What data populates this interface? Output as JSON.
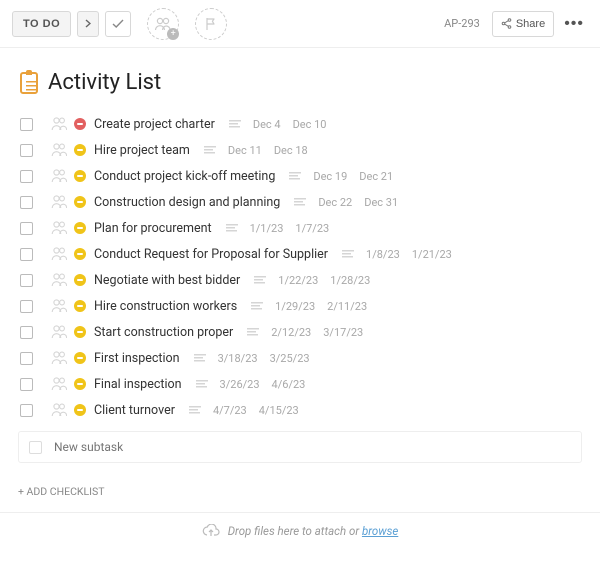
{
  "header": {
    "status_label": "TO DO",
    "task_id": "AP-293",
    "share_label": "Share"
  },
  "title": "Activity List",
  "tasks": [
    {
      "title": "Create project charter",
      "status": "red",
      "date1": "Dec 4",
      "date2": "Dec 10"
    },
    {
      "title": "Hire project team",
      "status": "yellow",
      "date1": "Dec 11",
      "date2": "Dec 18"
    },
    {
      "title": "Conduct project kick-off meeting",
      "status": "yellow",
      "date1": "Dec 19",
      "date2": "Dec 21"
    },
    {
      "title": "Construction design and planning",
      "status": "yellow",
      "date1": "Dec 22",
      "date2": "Dec 31"
    },
    {
      "title": "Plan for procurement",
      "status": "yellow",
      "date1": "1/1/23",
      "date2": "1/7/23"
    },
    {
      "title": "Conduct Request for Proposal for Supplier",
      "status": "yellow",
      "date1": "1/8/23",
      "date2": "1/21/23"
    },
    {
      "title": "Negotiate with best bidder",
      "status": "yellow",
      "date1": "1/22/23",
      "date2": "1/28/23"
    },
    {
      "title": "Hire construction workers",
      "status": "yellow",
      "date1": "1/29/23",
      "date2": "2/11/23"
    },
    {
      "title": "Start construction proper",
      "status": "yellow",
      "date1": "2/12/23",
      "date2": "3/17/23"
    },
    {
      "title": "First inspection",
      "status": "yellow",
      "date1": "3/18/23",
      "date2": "3/25/23"
    },
    {
      "title": "Final inspection",
      "status": "yellow",
      "date1": "3/26/23",
      "date2": "4/6/23"
    },
    {
      "title": "Client turnover",
      "status": "yellow",
      "date1": "4/7/23",
      "date2": "4/15/23"
    }
  ],
  "new_subtask_placeholder": "New subtask",
  "add_checklist_label": "+ ADD CHECKLIST",
  "dropzone_text": "Drop files here to attach or ",
  "dropzone_link": "browse"
}
